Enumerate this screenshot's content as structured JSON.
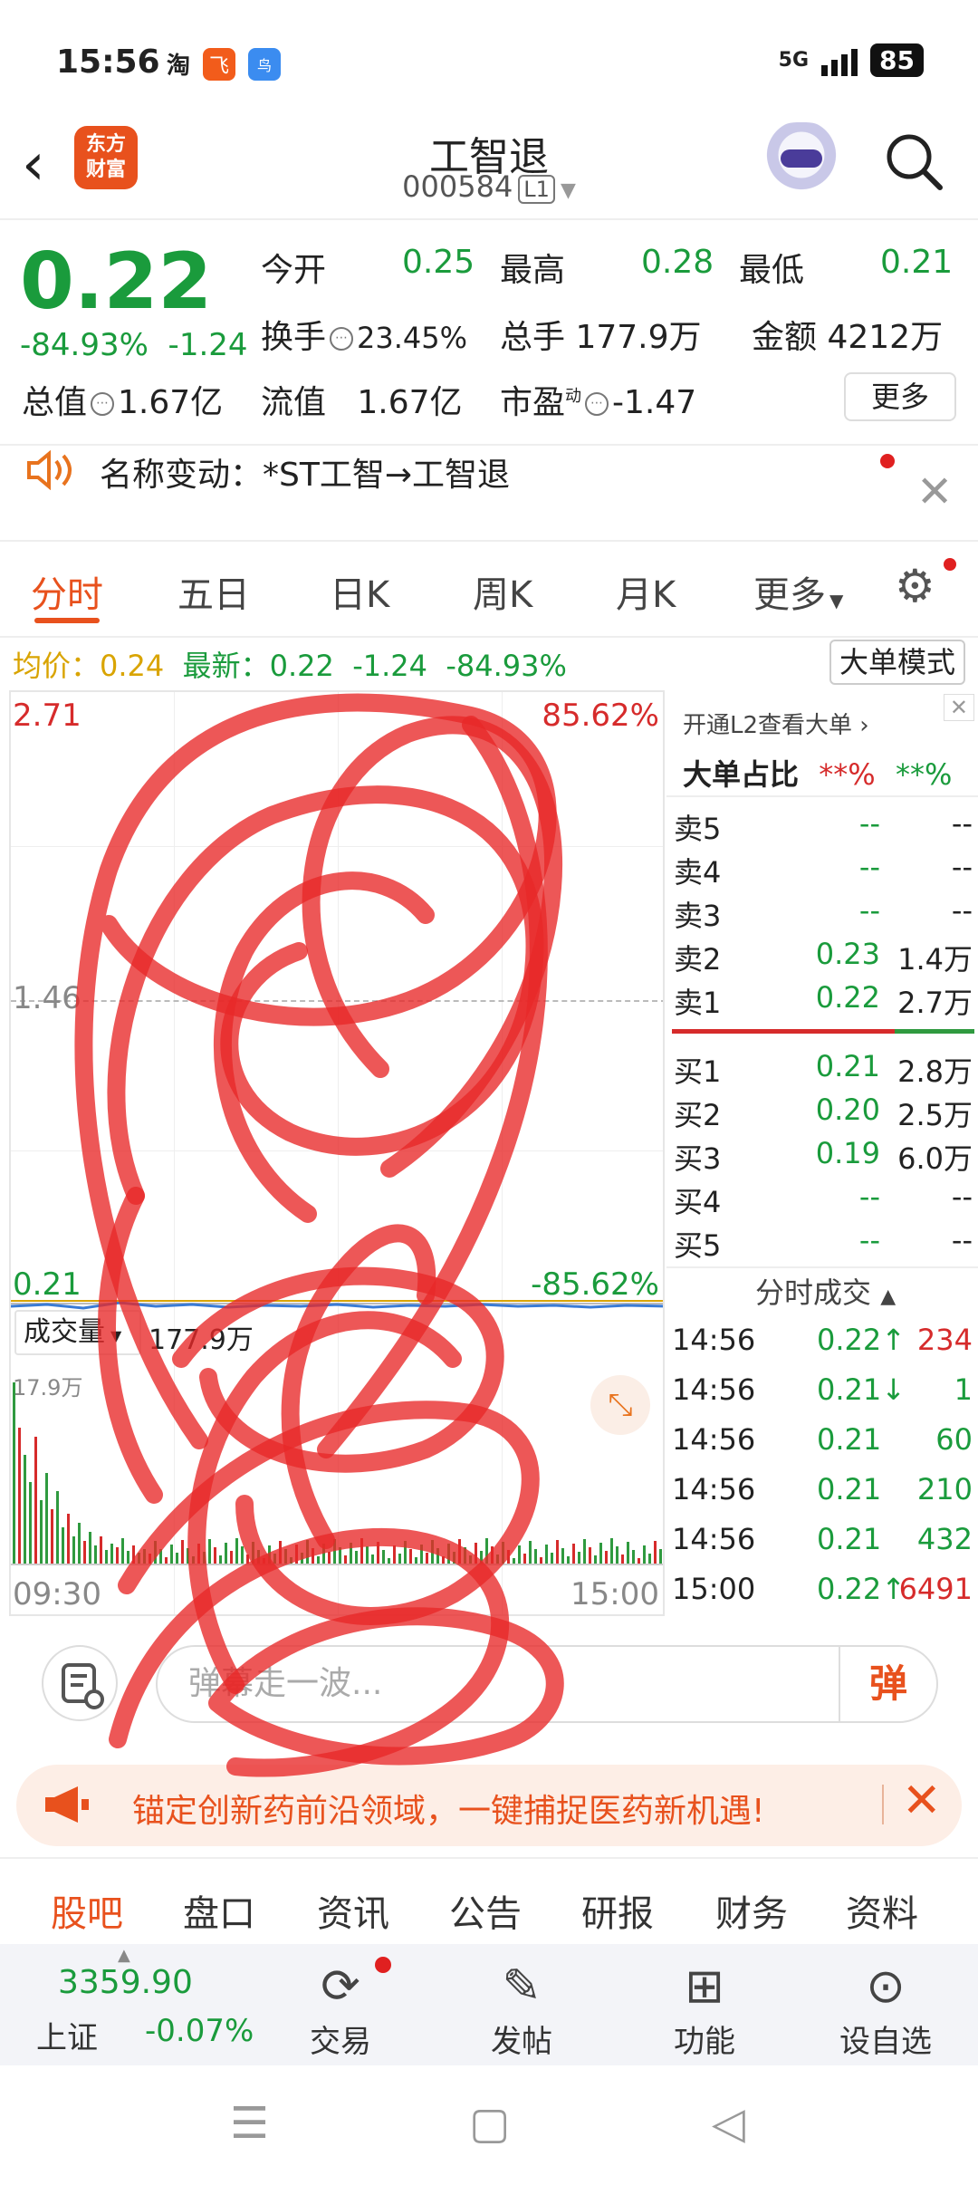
{
  "status_bar": {
    "time": "15:56",
    "app_icons": [
      "淘",
      "飞",
      "鸟"
    ],
    "network": "5G",
    "battery": "85"
  },
  "header": {
    "back_icon": "chevron-left-icon",
    "logo_text": "东方\n财富",
    "title": "工智退",
    "code": "000584",
    "level_badge": "L1",
    "robot_icon": "robot-avatar-icon",
    "search_icon": "search-icon"
  },
  "quote": {
    "price": "0.22",
    "change_pct": "-84.93%",
    "change": "-1.24",
    "open_label": "今开",
    "open": "0.25",
    "high_label": "最高",
    "high": "0.28",
    "low_label": "最低",
    "low": "0.21",
    "turnover_label": "换手",
    "turnover": "23.45%",
    "volume_label": "总手",
    "volume": "177.9万",
    "amount_label": "金额",
    "amount": "4212万",
    "mktcap_label": "总值",
    "mktcap": "1.67亿",
    "float_label": "流值",
    "float": "1.67亿",
    "pe_label": "市盈",
    "pe_sup": "动",
    "pe": "-1.47",
    "more_button": "更多"
  },
  "notice": {
    "text": "名称变动：*ST工智→工智退",
    "close_icon": "close-icon"
  },
  "chart_tabs": [
    "分时",
    "五日",
    "日K",
    "周K",
    "月K",
    "更多"
  ],
  "avg_line": {
    "avg_label": "均价：",
    "avg": "0.24",
    "latest_label": "最新：",
    "latest": "0.22",
    "change": "-1.24",
    "change_pct": "-84.93%",
    "mode_button": "大单模式"
  },
  "intraday": {
    "y_top": "2.71",
    "y_top_pct": "85.62%",
    "y_mid": "1.46",
    "y_bottom": "0.21",
    "y_bottom_pct": "-85.62%",
    "volume_selector": "成交量",
    "volume_total": "177.9万",
    "volume_max": "17.9万",
    "time_start": "09:30",
    "time_end": "15:00",
    "expand_icon": "expand-icon"
  },
  "orderbook": {
    "l2_link": "开通L2查看大单",
    "big_ratio_label": "大单占比",
    "big_ratio_buy": "**%",
    "big_ratio_sell": "**%",
    "asks": [
      {
        "name": "卖5",
        "price": "--",
        "vol": "--"
      },
      {
        "name": "卖4",
        "price": "--",
        "vol": "--"
      },
      {
        "name": "卖3",
        "price": "--",
        "vol": "--"
      },
      {
        "name": "卖2",
        "price": "0.23",
        "vol": "1.4万"
      },
      {
        "name": "卖1",
        "price": "0.22",
        "vol": "2.7万"
      }
    ],
    "bids": [
      {
        "name": "买1",
        "price": "0.21",
        "vol": "2.8万"
      },
      {
        "name": "买2",
        "price": "0.20",
        "vol": "2.5万"
      },
      {
        "name": "买3",
        "price": "0.19",
        "vol": "6.0万"
      },
      {
        "name": "买4",
        "price": "--",
        "vol": "--"
      },
      {
        "name": "买5",
        "price": "--",
        "vol": "--"
      }
    ],
    "trades_label": "分时成交",
    "trades": [
      {
        "time": "14:56",
        "price": "0.22↑",
        "vol": "234"
      },
      {
        "time": "14:56",
        "price": "0.21↓",
        "vol": "1"
      },
      {
        "time": "14:56",
        "price": "0.21",
        "vol": "60"
      },
      {
        "time": "14:56",
        "price": "0.21",
        "vol": "210"
      },
      {
        "time": "14:56",
        "price": "0.21",
        "vol": "432"
      },
      {
        "time": "15:00",
        "price": "0.22↑",
        "vol": "6491"
      }
    ]
  },
  "danmu": {
    "placeholder": "弹幕走一波...",
    "send_label": "弹"
  },
  "ad": {
    "text": "锚定创新药前沿领域，一键捕捉医药新机遇!"
  },
  "bottom_tabs": [
    "股吧",
    "盘口",
    "资讯",
    "公告",
    "研报",
    "财务",
    "资料"
  ],
  "toolbar": {
    "index_value": "3359.90",
    "index_name": "上证",
    "index_change": "-0.07%",
    "items": [
      "交易",
      "发帖",
      "功能",
      "设自选"
    ]
  },
  "colors": {
    "accent": "#e8511d",
    "down": "#1a9b3c",
    "up": "#d62b2b"
  }
}
